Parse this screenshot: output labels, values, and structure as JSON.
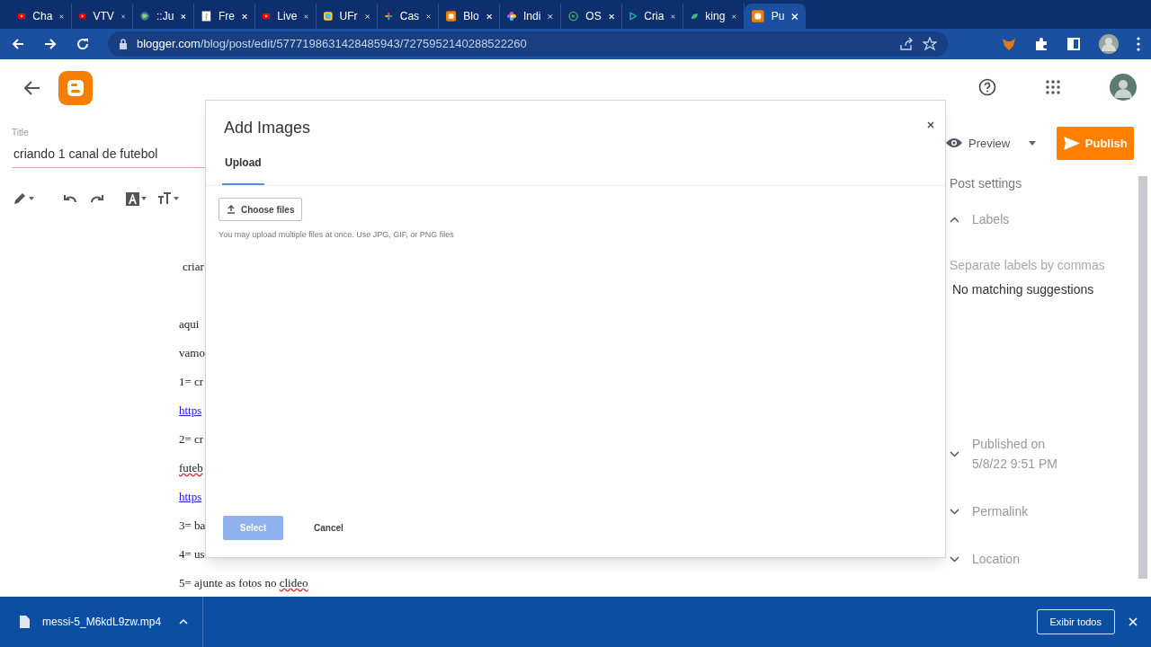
{
  "browser": {
    "tabs": [
      {
        "title": "Cha",
        "kind": "video",
        "selected": false
      },
      {
        "title": "VTV",
        "kind": "video",
        "selected": false
      },
      {
        "title": "::Ju",
        "kind": "globe",
        "selected": false
      },
      {
        "title": "Fre",
        "kind": "page",
        "selected": false
      },
      {
        "title": "Live",
        "kind": "video",
        "selected": false
      },
      {
        "title": "UFr",
        "kind": "app",
        "selected": false
      },
      {
        "title": "Cas",
        "kind": "pinwheel",
        "selected": false
      },
      {
        "title": "Blo",
        "kind": "blog",
        "selected": false
      },
      {
        "title": "Indi",
        "kind": "flower",
        "selected": false
      },
      {
        "title": "OS",
        "kind": "ring",
        "selected": false
      },
      {
        "title": "Cria",
        "kind": "play",
        "selected": false
      },
      {
        "title": "king",
        "kind": "leaf",
        "selected": false
      },
      {
        "title": "Pu",
        "kind": "blog",
        "selected": true
      }
    ],
    "address": {
      "host": "blogger.com",
      "path": "/blog/post/edit/5777198631428485943/7275952140288522260"
    }
  },
  "editor": {
    "title_label": "Title",
    "title": "criando 1 canal de futebol",
    "lines": [
      {
        "parts": [
          {
            "text": "criar",
            "kind": "text"
          }
        ]
      },
      {
        "parts": [
          {
            "text": "aqui",
            "kind": "text"
          }
        ]
      },
      {
        "parts": [
          {
            "text": "vamo",
            "kind": "text"
          }
        ]
      },
      {
        "parts": [
          {
            "text": "1= cr",
            "kind": "text"
          }
        ]
      },
      {
        "parts": [
          {
            "text": "https",
            "kind": "link"
          }
        ]
      },
      {
        "parts": [
          {
            "text": "2= cr",
            "kind": "text"
          }
        ]
      },
      {
        "parts": [
          {
            "text": "futeb",
            "kind": "misspelled"
          }
        ]
      },
      {
        "parts": [
          {
            "text": "https",
            "kind": "link"
          }
        ]
      },
      {
        "parts": [
          {
            "text": "3= ba",
            "kind": "text"
          }
        ]
      },
      {
        "parts": [
          {
            "text": "4= us",
            "kind": "text"
          }
        ]
      },
      {
        "parts": [
          {
            "text": "5= ajunte as fotos no ",
            "kind": "text"
          },
          {
            "text": "clideo",
            "kind": "misspelled"
          }
        ]
      }
    ]
  },
  "side_panel": {
    "preview": "Preview",
    "publish": "Publish",
    "settings_title": "Post settings",
    "sections": [
      {
        "label": "Labels",
        "expanded": true,
        "placeholder": "Separate labels by commas",
        "message": "No matching suggestions"
      },
      {
        "label": "Published on",
        "value": "5/8/22 9:51 PM",
        "expanded": false
      },
      {
        "label": "Permalink",
        "expanded": false
      },
      {
        "label": "Location",
        "expanded": false
      }
    ]
  },
  "dialog": {
    "title": "Add Images",
    "tabs": [
      {
        "label": "Upload",
        "selected": true
      }
    ],
    "choose_files": "Choose files",
    "hint": "You may upload multiple files at once. Use JPG, GIF, or PNG files",
    "select": {
      "label": "Select",
      "disabled": true
    },
    "cancel": "Cancel"
  },
  "download_bar": {
    "file": "messi-5_M6kdL9zw.mp4",
    "show_all": "Exibir todos"
  }
}
